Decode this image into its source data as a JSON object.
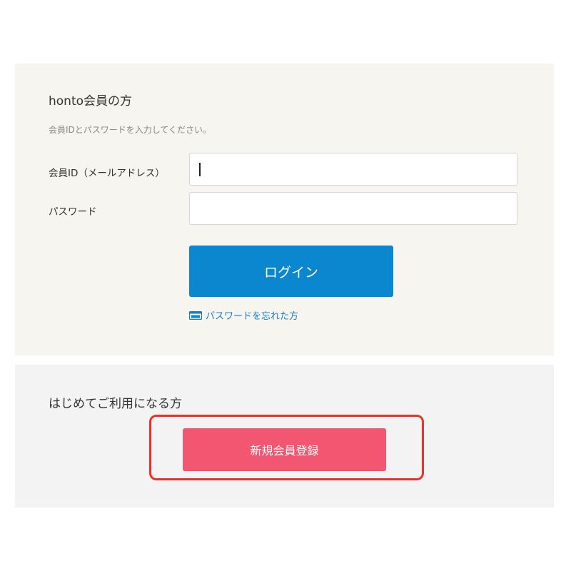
{
  "login": {
    "title": "honto会員の方",
    "instruction": "会員IDとパスワードを入力してください。",
    "id_label": "会員ID（メールアドレス）",
    "id_value": "",
    "password_label": "パスワード",
    "password_value": "",
    "login_button_label": "ログイン",
    "forgot_password_label": "パスワードを忘れた方",
    "forgot_password_icon": "window-icon"
  },
  "register": {
    "title": "はじめてご利用になる方",
    "register_button_label": "新規会員登録"
  },
  "colors": {
    "login_panel_bg": "#f6f5ef",
    "register_panel_bg": "#f3f3f3",
    "login_button": "#0a87cf",
    "register_button": "#f25671",
    "link": "#1a7fc4",
    "highlight": "#e8332c"
  }
}
